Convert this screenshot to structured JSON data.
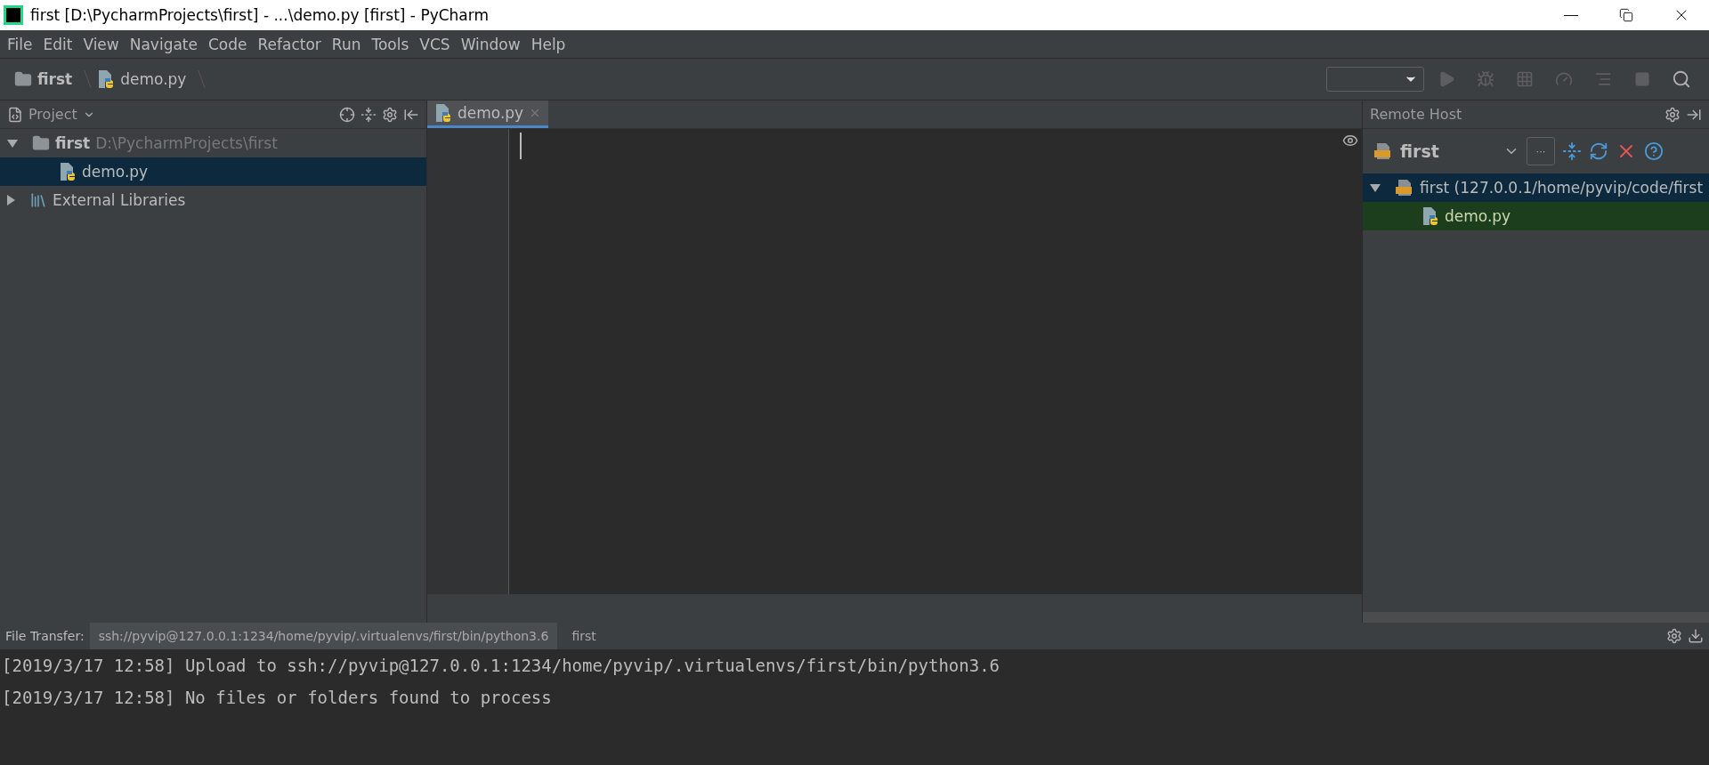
{
  "window": {
    "title": "first [D:\\PycharmProjects\\first] - ...\\demo.py [first] - PyCharm"
  },
  "menu": [
    "File",
    "Edit",
    "View",
    "Navigate",
    "Code",
    "Refactor",
    "Run",
    "Tools",
    "VCS",
    "Window",
    "Help"
  ],
  "breadcrumbs": [
    {
      "label": "first",
      "kind": "folder"
    },
    {
      "label": "demo.py",
      "kind": "python"
    }
  ],
  "project_panel": {
    "title": "Project",
    "tree": [
      {
        "label": "first",
        "path": "D:\\PycharmProjects\\first",
        "kind": "folder",
        "expanded": true,
        "selected": false,
        "children": [
          {
            "label": "demo.py",
            "kind": "python",
            "selected": true
          }
        ]
      },
      {
        "label": "External Libraries",
        "kind": "library",
        "expanded": false,
        "selected": false
      }
    ]
  },
  "editor": {
    "tabs": [
      {
        "label": "demo.py",
        "selected": true
      }
    ]
  },
  "remote_host": {
    "title": "Remote Host",
    "server": "first",
    "more": "···",
    "tree": [
      {
        "label": "first (127.0.0.1/home/pyvip/code/first",
        "kind": "sftp",
        "expanded": true,
        "selected": true,
        "children": [
          {
            "label": "demo.py",
            "kind": "python",
            "selected": false,
            "highlighted": true
          }
        ]
      }
    ]
  },
  "file_transfer": {
    "title": "File Transfer:",
    "tabs": [
      {
        "label": "ssh://pyvip@127.0.0.1:1234/home/pyvip/.virtualenvs/first/bin/python3.6",
        "selected": true
      },
      {
        "label": "first",
        "selected": false
      }
    ],
    "log": [
      "[2019/3/17 12:58] Upload to ssh://pyvip@127.0.0.1:1234/home/pyvip/.virtualenvs/first/bin/python3.6",
      "[2019/3/17 12:58] No files or folders found to process"
    ]
  }
}
